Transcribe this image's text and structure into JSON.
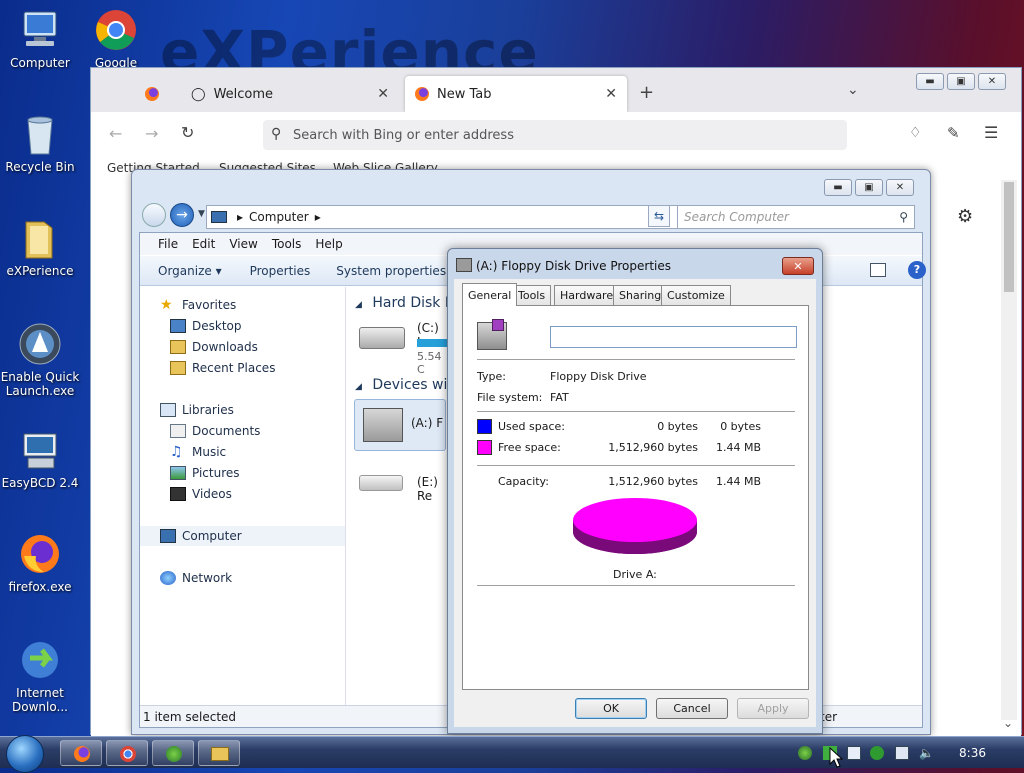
{
  "desktop": {
    "watermark": "eXPerience",
    "icons": [
      {
        "label": "Computer"
      },
      {
        "label": "Google"
      },
      {
        "label": "Recycle Bin"
      },
      {
        "label": "eXPerience"
      },
      {
        "label": "Enable Quick Launch.exe"
      },
      {
        "label": "EasyBCD 2.4"
      },
      {
        "label": "firefox.exe"
      },
      {
        "label": "Internet Downlo..."
      }
    ]
  },
  "firefox": {
    "tabs": [
      {
        "label": "Welcome"
      },
      {
        "label": "New Tab"
      }
    ],
    "new_tab_symbol": "+",
    "url_placeholder": "Search with Bing or enter address",
    "bookmarks": [
      "Getting Started",
      "Suggested Sites",
      "Web Slice Gallery"
    ]
  },
  "explorer": {
    "address": "Computer",
    "search_placeholder": "Search Computer",
    "menu": [
      "File",
      "Edit",
      "View",
      "Tools",
      "Help"
    ],
    "commands": [
      "Organize ▾",
      "Properties",
      "System properties"
    ],
    "nav": {
      "favorites": "Favorites",
      "fav_items": [
        "Desktop",
        "Downloads",
        "Recent Places"
      ],
      "libraries": "Libraries",
      "lib_items": [
        "Documents",
        "Music",
        "Pictures",
        "Videos"
      ],
      "computer": "Computer",
      "network": "Network"
    },
    "groups": {
      "hard_disk": "Hard Disk D",
      "devices": "Devices with"
    },
    "items": {
      "c_drive": "(C:) L",
      "c_size": "5.54 C",
      "a_drive": "(A:) F",
      "e_drive": "(E:) Re"
    },
    "status": "1 item selected",
    "status_right": "ter"
  },
  "dialog": {
    "title": "(A:) Floppy Disk Drive Properties",
    "tabs": [
      "General",
      "Tools",
      "Hardware",
      "Sharing",
      "Customize"
    ],
    "name_value": "",
    "type_label": "Type:",
    "type_value": "Floppy Disk Drive",
    "fs_label": "File system:",
    "fs_value": "FAT",
    "used_label": "Used space:",
    "used_bytes": "0 bytes",
    "used_short": "0 bytes",
    "free_label": "Free space:",
    "free_bytes": "1,512,960 bytes",
    "free_short": "1.44 MB",
    "cap_label": "Capacity:",
    "cap_bytes": "1,512,960 bytes",
    "cap_short": "1.44 MB",
    "drive_label": "Drive A:",
    "used_color": "#0000ff",
    "free_color": "#ff00ff",
    "ok": "OK",
    "cancel": "Cancel",
    "apply": "Apply"
  },
  "taskbar": {
    "clock": "8:36"
  }
}
